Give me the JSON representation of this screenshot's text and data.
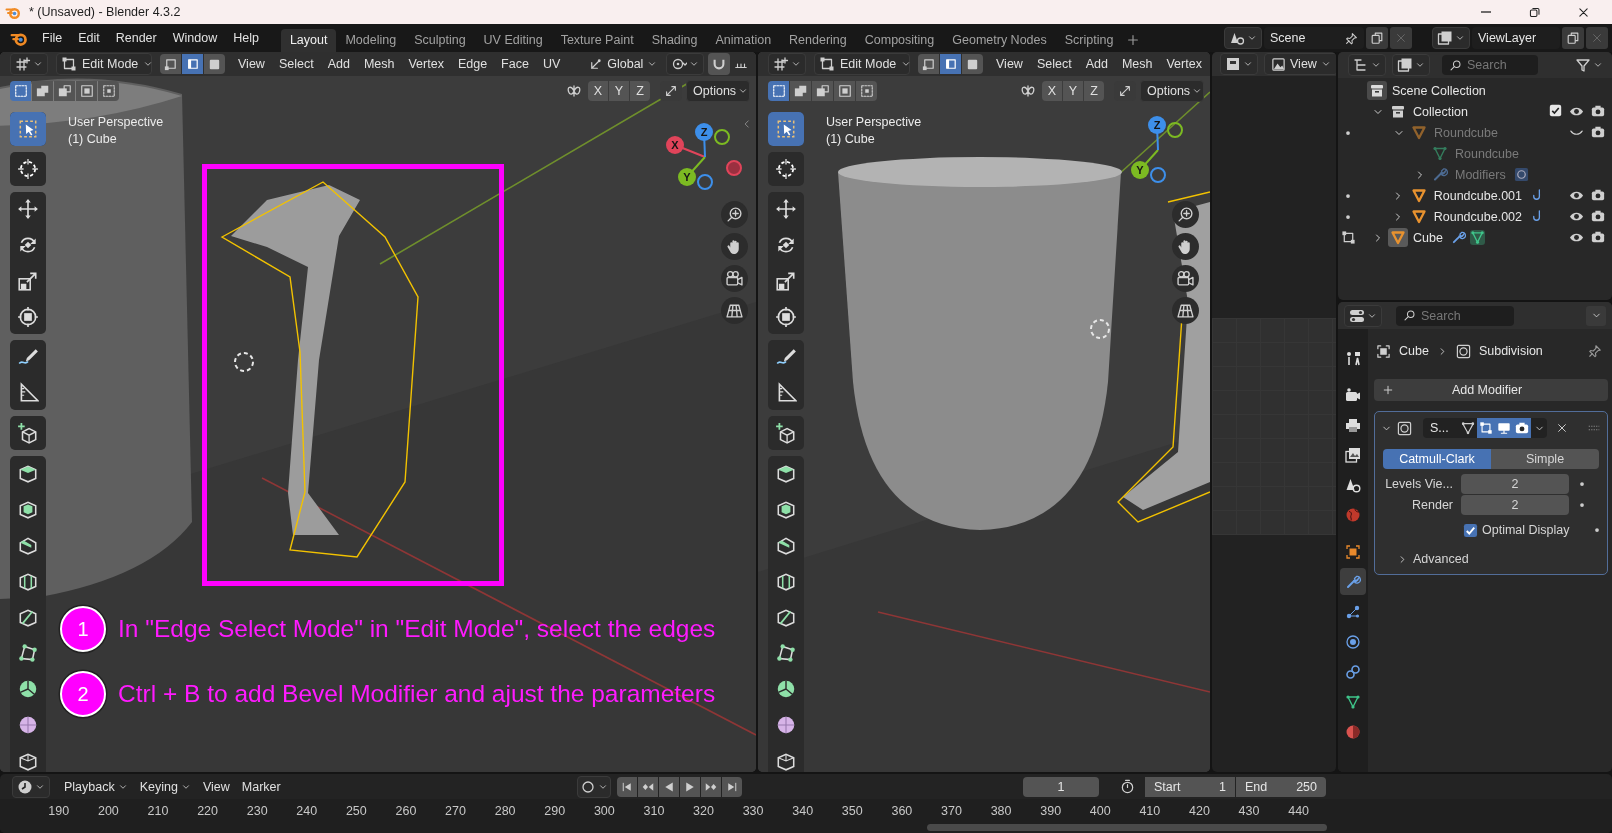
{
  "window": {
    "title": "* (Unsaved) - Blender 4.3.2"
  },
  "menu": [
    "File",
    "Edit",
    "Render",
    "Window",
    "Help"
  ],
  "workspaces": [
    {
      "label": "Layout",
      "selected": true
    },
    {
      "label": "Modeling",
      "selected": false
    },
    {
      "label": "Sculpting",
      "selected": false
    },
    {
      "label": "UV Editing",
      "selected": false
    },
    {
      "label": "Texture Paint",
      "selected": false
    },
    {
      "label": "Shading",
      "selected": false
    },
    {
      "label": "Animation",
      "selected": false
    },
    {
      "label": "Rendering",
      "selected": false
    },
    {
      "label": "Compositing",
      "selected": false
    },
    {
      "label": "Geometry Nodes",
      "selected": false
    },
    {
      "label": "Scripting",
      "selected": false
    }
  ],
  "scene": {
    "name": "Scene"
  },
  "view_layer": {
    "name": "ViewLayer"
  },
  "viewports": [
    {
      "mode": "Edit Mode",
      "select_modes": [
        {
          "kind": "vertex",
          "selected": false
        },
        {
          "kind": "edge",
          "selected": true
        },
        {
          "kind": "face",
          "selected": false
        }
      ],
      "menus": [
        "View",
        "Select",
        "Add",
        "Mesh",
        "Vertex",
        "Edge",
        "Face",
        "UV"
      ],
      "orientation": "Global",
      "selection_ops": [
        {
          "kind": "set",
          "selected": true
        },
        {
          "kind": "extend",
          "selected": false
        },
        {
          "kind": "subtract",
          "selected": false
        },
        {
          "kind": "invert",
          "selected": false
        },
        {
          "kind": "intersect",
          "selected": false
        }
      ],
      "mirror": [
        "X",
        "Y",
        "Z"
      ],
      "options": "Options",
      "info": [
        "User Perspective",
        "(1) Cube"
      ],
      "gizmo": [
        {
          "kind": "x",
          "label": "X"
        },
        {
          "kind": "y",
          "label": "Y"
        },
        {
          "kind": "z",
          "label": "Z"
        }
      ],
      "tools": [
        {
          "kind": "select_box",
          "selected": true
        },
        {
          "kind": "cursor",
          "selected": false
        },
        {
          "kind": "move",
          "selected": false
        },
        {
          "kind": "rotate",
          "selected": false
        },
        {
          "kind": "scale",
          "selected": false
        },
        {
          "kind": "transform",
          "selected": false
        },
        {
          "kind": "annotate",
          "selected": false
        },
        {
          "kind": "measure",
          "selected": false
        },
        {
          "kind": "add_cube",
          "selected": false
        },
        {
          "kind": "extrude",
          "selected": false
        },
        {
          "kind": "inset",
          "selected": false
        },
        {
          "kind": "bevel",
          "selected": false
        },
        {
          "kind": "loop_cut",
          "selected": false
        },
        {
          "kind": "knife",
          "selected": false
        },
        {
          "kind": "poly_build",
          "selected": false
        },
        {
          "kind": "spin",
          "selected": false
        },
        {
          "kind": "smooth",
          "selected": false
        },
        {
          "kind": "shrink",
          "selected": false
        }
      ],
      "highlight": true,
      "annotations": [
        {
          "number": "1",
          "text": "In \"Edge Select Mode\" in \"Edit Mode\", select the edges"
        },
        {
          "number": "2",
          "text": "Ctrl + B to add Bevel Modifier and ajust the parameters"
        }
      ]
    },
    {
      "mode": "Edit Mode",
      "select_modes": [
        {
          "kind": "vertex",
          "selected": false
        },
        {
          "kind": "edge",
          "selected": true
        },
        {
          "kind": "face",
          "selected": false
        }
      ],
      "menus": [
        "View",
        "Select",
        "Add",
        "Mesh",
        "Vertex"
      ],
      "selection_ops": [
        {
          "kind": "set",
          "selected": true
        },
        {
          "kind": "extend",
          "selected": false
        },
        {
          "kind": "subtract",
          "selected": false
        },
        {
          "kind": "invert",
          "selected": false
        },
        {
          "kind": "intersect",
          "selected": false
        }
      ],
      "mirror": [
        "X",
        "Y",
        "Z"
      ],
      "options": "Options",
      "info": [
        "User Perspective",
        "(1) Cube"
      ],
      "gizmo": [
        {
          "kind": "y",
          "label": "Y"
        },
        {
          "kind": "z",
          "label": "Z"
        }
      ],
      "tools": [
        {
          "kind": "select_box",
          "selected": true
        },
        {
          "kind": "cursor",
          "selected": false
        },
        {
          "kind": "move",
          "selected": false
        },
        {
          "kind": "rotate",
          "selected": false
        },
        {
          "kind": "scale",
          "selected": false
        },
        {
          "kind": "transform",
          "selected": false
        },
        {
          "kind": "annotate",
          "selected": false
        },
        {
          "kind": "measure",
          "selected": false
        },
        {
          "kind": "add_cube",
          "selected": false
        },
        {
          "kind": "extrude",
          "selected": false
        },
        {
          "kind": "inset",
          "selected": false
        },
        {
          "kind": "bevel",
          "selected": false
        },
        {
          "kind": "loop_cut",
          "selected": false
        },
        {
          "kind": "knife",
          "selected": false
        },
        {
          "kind": "poly_build",
          "selected": false
        },
        {
          "kind": "spin",
          "selected": false
        },
        {
          "kind": "smooth",
          "selected": false
        },
        {
          "kind": "shrink",
          "selected": false
        }
      ]
    }
  ],
  "image_editor": {
    "menu": "View"
  },
  "outliner": {
    "search_placeholder": "Search",
    "tree": [
      {
        "kind": "scene_collection",
        "label": "Scene Collection",
        "children": [
          {
            "kind": "collection",
            "label": "Collection",
            "expanded": true,
            "checked": true,
            "hidden": false,
            "selected": false,
            "children": [
              {
                "kind": "object",
                "label": "Roundcube",
                "expanded": true,
                "hidden": true,
                "editing": false,
                "selected": false,
                "children": [
                  {
                    "kind": "mesh",
                    "label": "Roundcube",
                    "selected": false
                  },
                  {
                    "kind": "modifiers",
                    "label": "Modifiers",
                    "expanded": false,
                    "selected": false,
                    "subdivided": true
                  }
                ]
              },
              {
                "kind": "object",
                "label": "Roundcube.001",
                "expanded": false,
                "hidden": false,
                "editing": false,
                "selected": false,
                "hooked": true
              },
              {
                "kind": "object",
                "label": "Roundcube.002",
                "expanded": false,
                "hidden": false,
                "editing": false,
                "selected": false,
                "hooked": true
              }
            ]
          },
          {
            "kind": "object",
            "label": "Cube",
            "expanded": false,
            "hidden": false,
            "editing": true,
            "selected": true,
            "modified": true,
            "has_mesh": true
          }
        ]
      }
    ]
  },
  "properties": {
    "search_placeholder": "Search",
    "tabs": [
      {
        "kind": "tool",
        "selected": false
      },
      {
        "kind": "render",
        "selected": false
      },
      {
        "kind": "output",
        "selected": false
      },
      {
        "kind": "view_layer",
        "selected": false
      },
      {
        "kind": "scene",
        "selected": false
      },
      {
        "kind": "world",
        "selected": false
      },
      {
        "kind": "object",
        "selected": false
      },
      {
        "kind": "modifiers",
        "selected": true
      },
      {
        "kind": "particles",
        "selected": false
      },
      {
        "kind": "physics",
        "selected": false
      },
      {
        "kind": "constraints",
        "selected": false
      },
      {
        "kind": "data",
        "selected": false
      },
      {
        "kind": "material",
        "selected": false
      }
    ],
    "breadcrumb": [
      "Cube",
      "Subdivision"
    ],
    "add_button": "Add Modifier",
    "modifier": {
      "name": "S...",
      "expanded": true,
      "toggles": [
        {
          "kind": "on_cage",
          "on": false
        },
        {
          "kind": "edit_mode",
          "on": true
        },
        {
          "kind": "viewport",
          "on": true
        },
        {
          "kind": "render",
          "on": true
        }
      ],
      "types": [
        {
          "label": "Catmull-Clark",
          "selected": true
        },
        {
          "label": "Simple",
          "selected": false
        }
      ],
      "fields": [
        {
          "label": "Levels Vie...",
          "value": "2"
        },
        {
          "label": "Render",
          "value": "2"
        }
      ],
      "optimal_display": {
        "label": "Optimal Display",
        "checked": true
      },
      "advanced": {
        "label": "Advanced",
        "expanded": false
      }
    }
  },
  "timeline": {
    "menus": [
      {
        "kind": "dropdown",
        "label": "Playback"
      },
      {
        "kind": "dropdown",
        "label": "Keying"
      },
      {
        "kind": "menu",
        "label": "View"
      },
      {
        "kind": "menu",
        "label": "Marker"
      }
    ],
    "current_frame": "1",
    "start_label": "Start",
    "start": "1",
    "end_label": "End",
    "end": "250",
    "ruler": [
      "190",
      "200",
      "210",
      "220",
      "230",
      "240",
      "250",
      "260",
      "270",
      "280",
      "290",
      "300",
      "310",
      "320",
      "330",
      "340",
      "350",
      "360",
      "370",
      "380",
      "390",
      "400",
      "410",
      "420",
      "430",
      "440"
    ]
  }
}
